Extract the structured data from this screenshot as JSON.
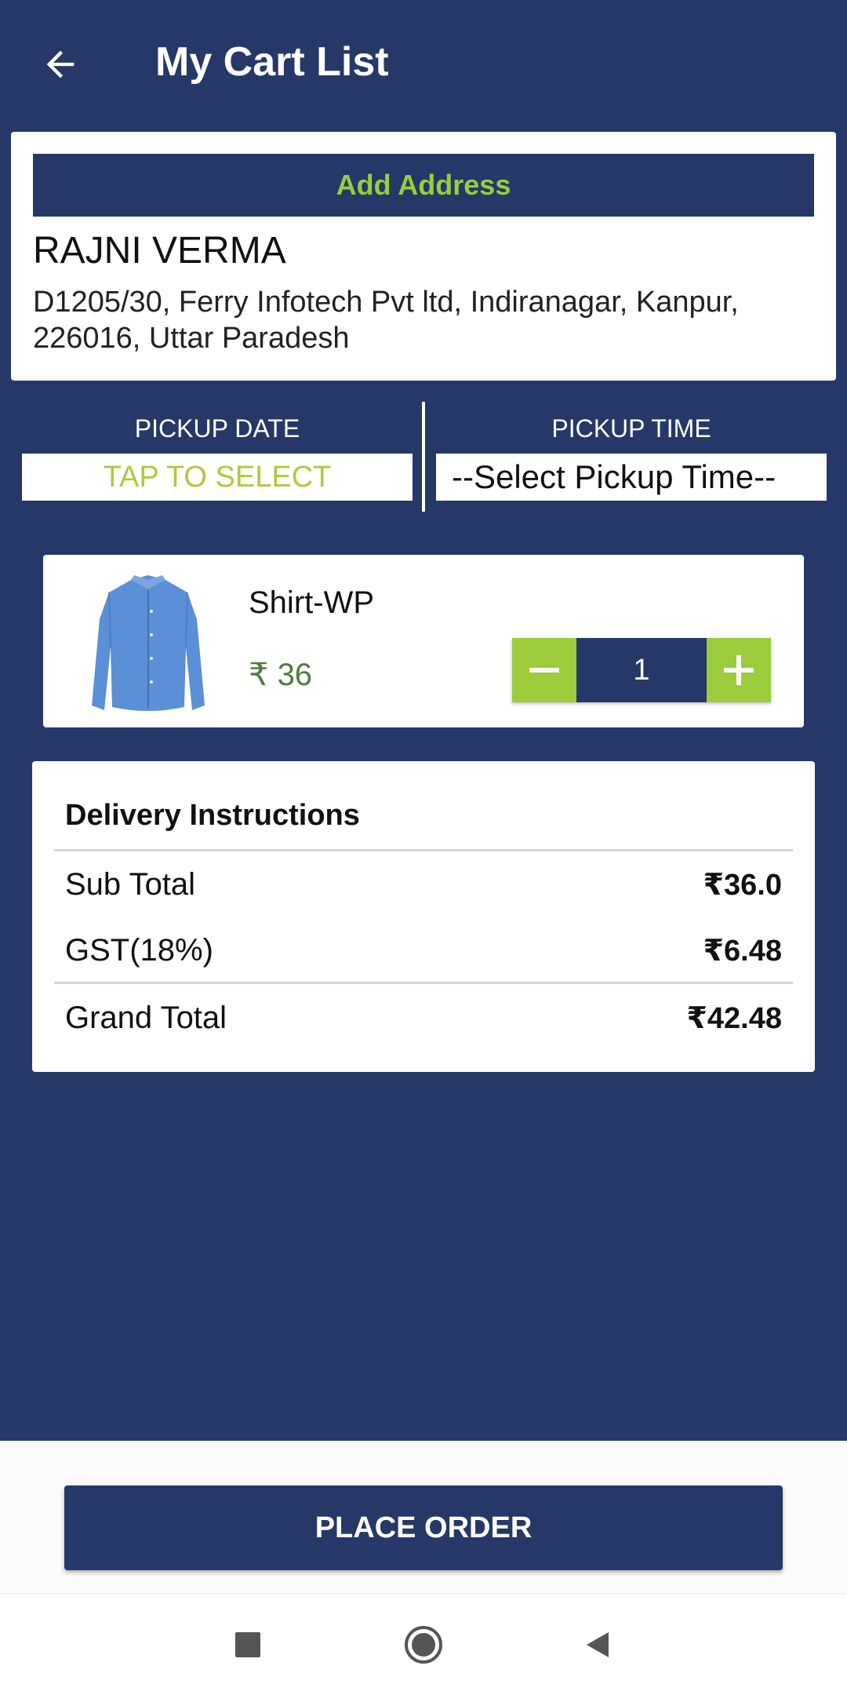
{
  "toolbar": {
    "title": "My Cart List",
    "back_icon": "arrow-left-icon"
  },
  "address": {
    "add_button_label": "Add Address",
    "name": "RAJNI VERMA",
    "line1": "D1205/30, Ferry Infotech Pvt ltd, Indiranagar, Kanpur,",
    "line2": "226016, Uttar Paradesh"
  },
  "pickup": {
    "date_label": "PICKUP DATE",
    "date_value": "TAP TO SELECT",
    "time_label": "PICKUP TIME",
    "time_value": "--Select Pickup Time--"
  },
  "cart_item": {
    "name": "Shirt-WP",
    "price": "₹ 36",
    "quantity": "1",
    "image_icon": "shirt-icon",
    "minus_icon": "minus-icon",
    "plus_icon": "plus-icon"
  },
  "summary": {
    "title": "Delivery Instructions",
    "sub_total_label": "Sub Total",
    "sub_total_value": "₹36.0",
    "gst_label": "GST(18%)",
    "gst_value": "₹6.48",
    "grand_total_label": "Grand Total",
    "grand_total_value": "₹42.48"
  },
  "actions": {
    "place_order_label": "PLACE ORDER"
  },
  "nav": {
    "recents_icon": "square-icon",
    "home_icon": "circle-icon",
    "back_icon": "triangle-back-icon"
  },
  "colors": {
    "primary": "#263868",
    "accent": "#9ccc3c",
    "price_green": "#4f7b3f"
  }
}
